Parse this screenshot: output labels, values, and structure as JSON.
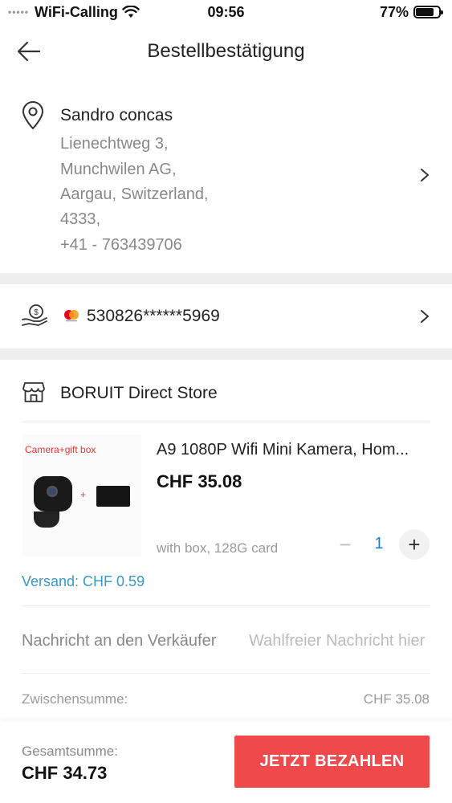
{
  "status_bar": {
    "carrier": "WiFi-Calling",
    "time": "09:56",
    "battery_percent": "77%",
    "battery_level": 0.77
  },
  "header": {
    "title": "Bestellbestätigung",
    "back_icon": "arrow-left-icon"
  },
  "address": {
    "icon": "location-pin-icon",
    "name": "Sandro concas",
    "lines": [
      "Lienechtweg 3,",
      "Munchwilen AG,",
      "Aargau, Switzerland,",
      "4333,",
      "+41 - 763439706"
    ]
  },
  "payment": {
    "icon": "payment-hand-icon",
    "card_brand_icon": "mastercard-icon",
    "card_number": "530826******5969"
  },
  "store": {
    "icon": "store-icon",
    "name": "BORUIT Direct Store",
    "product": {
      "image_caption": "Camera+gift box",
      "image_plus": "+",
      "title": "A9 1080P Wifi Mini Kamera, Hom...",
      "price": "CHF 35.08",
      "variant": "with box, 128G card",
      "quantity": "1",
      "minus": "−",
      "plus": "+"
    },
    "shipping": "Versand: CHF 0.59",
    "message_label": "Nachricht an den Verkäufer",
    "message_placeholder": "Wahlfreier Nachricht hier",
    "subtotal_label": "Zwischensumme:",
    "subtotal_value": "CHF 35.08"
  },
  "footer": {
    "total_label": "Gesamtsumme:",
    "total_value": "CHF 34.73",
    "pay_button": "JETZT BEZAHLEN"
  },
  "colors": {
    "accent_red": "#f0494c",
    "link_blue": "#3a97c9",
    "qty_blue": "#1a7fc1"
  }
}
